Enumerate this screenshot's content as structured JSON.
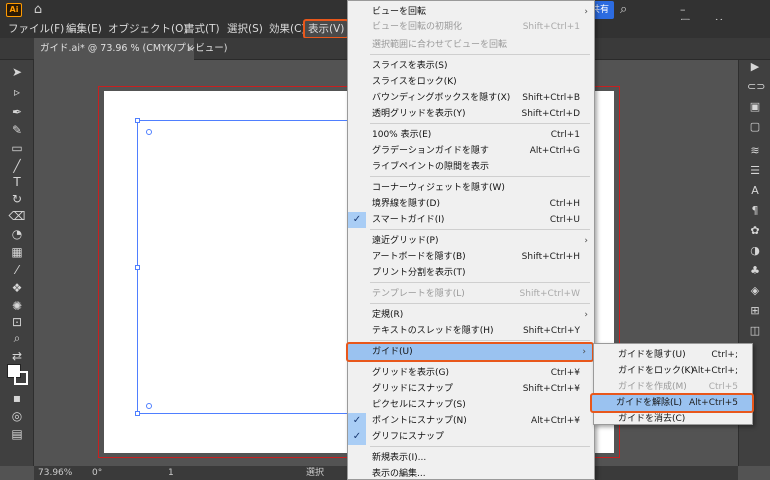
{
  "app": {
    "logo": "Ai",
    "share_label": "共有"
  },
  "menubar": {
    "items": [
      "ファイル(F)",
      "編集(E)",
      "オブジェクト(O)",
      "書式(T)",
      "選択(S)",
      "効果(C)",
      "表示(V)"
    ]
  },
  "document_tab": {
    "title": "ガイド.ai* @ 73.96 % (CMYK/プレビュー)",
    "close": "×"
  },
  "status": {
    "zoom": "73.96%",
    "rotation": "0°",
    "artboard": "1",
    "mode": "選択"
  },
  "view_menu": {
    "items": [
      {
        "label": "ビューを回転",
        "shortcut": "",
        "submenu": true,
        "disabled": false
      },
      {
        "label": "ビューを回転の初期化",
        "shortcut": "Shift+Ctrl+1",
        "disabled": true
      },
      {
        "label": "選択範囲に合わせてビューを回転",
        "shortcut": "",
        "disabled": true
      },
      {
        "label": "スライスを表示(S)",
        "shortcut": ""
      },
      {
        "label": "スライスをロック(K)",
        "shortcut": ""
      },
      {
        "label": "バウンディングボックスを隠す(X)",
        "shortcut": "Shift+Ctrl+B"
      },
      {
        "label": "透明グリッドを表示(Y)",
        "shortcut": "Shift+Ctrl+D"
      },
      {
        "label": "100% 表示(E)",
        "shortcut": "Ctrl+1"
      },
      {
        "label": "グラデーションガイドを隠す",
        "shortcut": "Alt+Ctrl+G"
      },
      {
        "label": "ライブペイントの隙間を表示",
        "shortcut": ""
      },
      {
        "label": "コーナーウィジェットを隠す(W)",
        "shortcut": ""
      },
      {
        "label": "境界線を隠す(D)",
        "shortcut": "Ctrl+H"
      },
      {
        "label": "スマートガイド(I)",
        "shortcut": "Ctrl+U",
        "checked": true
      },
      {
        "label": "遠近グリッド(P)",
        "shortcut": "",
        "submenu": true
      },
      {
        "label": "アートボードを隠す(B)",
        "shortcut": "Shift+Ctrl+H"
      },
      {
        "label": "プリント分割を表示(T)",
        "shortcut": ""
      },
      {
        "label": "テンプレートを隠す(L)",
        "shortcut": "Shift+Ctrl+W",
        "disabled": true
      },
      {
        "label": "定規(R)",
        "shortcut": "",
        "submenu": true
      },
      {
        "label": "テキストのスレッドを隠す(H)",
        "shortcut": "Shift+Ctrl+Y"
      },
      {
        "label": "ガイド(U)",
        "shortcut": "",
        "submenu": true,
        "highlighted": true
      },
      {
        "label": "グリッドを表示(G)",
        "shortcut": "Ctrl+¥"
      },
      {
        "label": "グリッドにスナップ",
        "shortcut": "Shift+Ctrl+¥"
      },
      {
        "label": "ピクセルにスナップ(S)",
        "shortcut": ""
      },
      {
        "label": "ポイントにスナップ(N)",
        "shortcut": "Alt+Ctrl+¥",
        "checked": true
      },
      {
        "label": "グリフにスナップ",
        "shortcut": "",
        "checked": true
      },
      {
        "label": "新規表示(I)...",
        "shortcut": ""
      },
      {
        "label": "表示の編集...",
        "shortcut": ""
      }
    ],
    "submenu_arrow": "›",
    "checkmark": "✓"
  },
  "guide_submenu": {
    "items": [
      {
        "label": "ガイドを隠す(U)",
        "shortcut": "Ctrl+;"
      },
      {
        "label": "ガイドをロック(K)",
        "shortcut": "Alt+Ctrl+;"
      },
      {
        "label": "ガイドを作成(M)",
        "shortcut": "Ctrl+5",
        "disabled": true
      },
      {
        "label": "ガイドを解除(L)",
        "shortcut": "Alt+Ctrl+5",
        "highlighted": true
      },
      {
        "label": "ガイドを消去(C)",
        "shortcut": ""
      }
    ]
  },
  "colors": {
    "accent_outline": "#e8571b",
    "highlight": "#9ac2f0",
    "guide": "#4f7fff",
    "bleed": "#c82020"
  }
}
